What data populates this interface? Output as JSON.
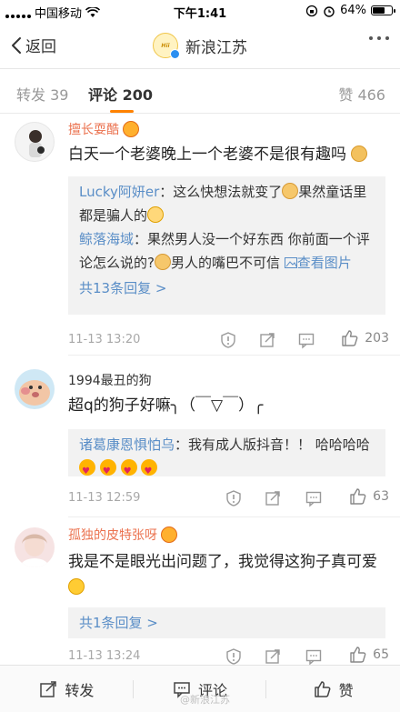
{
  "status_bar": {
    "carrier": "中国移动",
    "time": "下午1:41",
    "battery": "64%",
    "battery_level": 0.64
  },
  "nav": {
    "back_label": "返回",
    "title": "新浪江苏",
    "logo_text": "Hiinews 新浪江苏"
  },
  "tabs": {
    "repost": "转发 39",
    "comment": "评论 200",
    "like": "赞 466"
  },
  "comments": [
    {
      "username": "擅长耍酷",
      "text": "白天一个老婆晚上一个老婆不是很有趣吗",
      "replies": [
        {
          "name": "Lucky阿妍er",
          "text": "：这么快想法就变了",
          "text2": "果然童话里都是骗人的"
        },
        {
          "name": "鲸落海域",
          "text": "：果然男人没一个好东西 你前面一个评论怎么说的?",
          "text2": "男人的嘴巴不可信",
          "link": "查看图片"
        }
      ],
      "more": "共13条回复 >",
      "time": "11-13 13:20",
      "likes": "203"
    },
    {
      "username": "1994最丑的狗",
      "text": "超q的狗子好嘛╮（￣▽￣）╭",
      "replies": [
        {
          "name": "诸葛康恩惧怕乌",
          "text": "：我有成人版抖音！！ 哈哈哈哈"
        }
      ],
      "time": "11-13 12:59",
      "likes": "63"
    },
    {
      "username": "孤独的皮特张呀",
      "text": "我是不是眼光出问题了，我觉得这狗子真可爱",
      "more": "共1条回复 >",
      "time": "11-13 13:24",
      "likes": "65"
    }
  ],
  "bottom_bar": {
    "repost": "转发",
    "comment": "评论",
    "like": "赞"
  },
  "watermark": "@新浪江苏"
}
